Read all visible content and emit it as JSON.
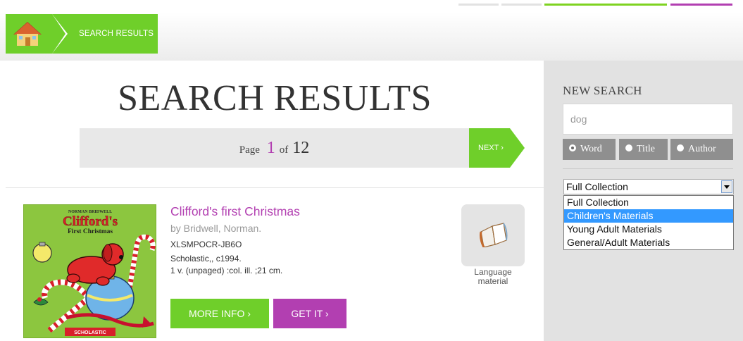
{
  "breadcrumb": {
    "home_icon": "home-icon",
    "current": "SEARCH RESULTS"
  },
  "main": {
    "title": "SEARCH RESULTS",
    "pager": {
      "page_word": "Page",
      "current_page": "1",
      "of_word": "of",
      "total_pages": "12",
      "next_label": "NEXT ›"
    }
  },
  "result": {
    "cover": {
      "author_line": "NORMAN BRIDWELL",
      "title_line1": "Clifford's",
      "title_line2": "First Christmas",
      "publisher_badge": "SCHOLASTIC"
    },
    "title": "Clifford's first Christmas",
    "author": "by Bridwell, Norman.",
    "id": "XLSMPOCR-JB6O",
    "publisher": "Scholastic,, c1994.",
    "description": "1 v. (unpaged) :col. ill. ;21 cm.",
    "more_info_label": "MORE INFO ›",
    "get_it_label": "GET IT ›",
    "format_icon": "open-book-icon",
    "format_label": "Language material"
  },
  "sidebar": {
    "title": "NEW SEARCH",
    "search_value": "dog",
    "search_types": [
      {
        "label": "Word",
        "selected": true
      },
      {
        "label": "Title",
        "selected": false
      },
      {
        "label": "Author",
        "selected": false
      }
    ],
    "collection_selected": "Full Collection",
    "collection_options": [
      "Full Collection",
      "Children's Materials",
      "Young Adult Materials",
      "General/Adult Materials"
    ],
    "highlighted_option": "Children's Materials"
  },
  "colors": {
    "green": "#6fcf2a",
    "purple": "#b23fb1",
    "sidebar_bg": "#e2e2e2",
    "highlight": "#3399ff"
  }
}
